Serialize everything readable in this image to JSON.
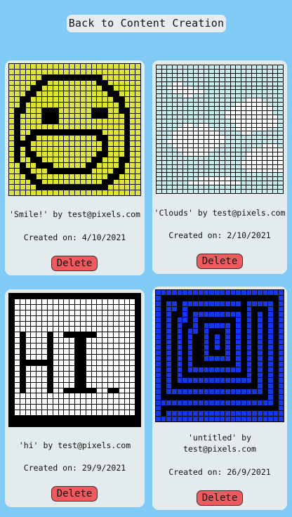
{
  "header": {
    "back_label": "Back to Content Creation"
  },
  "colors": {
    "page_bg": "#7fcbf5",
    "card_bg": "#e4ebec",
    "delete_bg": "#ef5a5f",
    "grid_line": "#000000"
  },
  "cards": [
    {
      "caption": "'Smile!' by test@pixels.com",
      "created": "Created on: 4/10/2021",
      "delete_label": "Delete",
      "palette": {
        "0": "#dde23c",
        "1": "#000000"
      },
      "pixels": [
        "000000000000000000000000",
        "000000000000000000000000",
        "000000111111111110000000",
        "000001100000000011000000",
        "000011000000000001100000",
        "000110000000000000110000",
        "001100000000000000011000",
        "001000000000000000001000",
        "011000111000000111001100",
        "010000111000000111000100",
        "010000111000000000000100",
        "010000000000000000000100",
        "010011111111111110000100",
        "010110000000000011000100",
        "011100000000000001000100",
        "010100000000000001000100",
        "010110000000000011000100",
        "010011000000000110001100",
        "001001110000001100001000",
        "001100011111111000011000",
        "000110000000000000110000",
        "000011000000000001100000",
        "000001111111111111000000",
        "000000000000000000000000"
      ]
    },
    {
      "caption": "'Clouds' by test@pixels.com",
      "created": "Created on: 2/10/2021",
      "delete_label": "Delete",
      "palette": {
        "0": "#c6ecef",
        "1": "#ffffff"
      },
      "pixels": [
        "000000000000000000000000",
        "000000000000000000000000",
        "000000000000000000000000",
        "000000000000000000000000",
        "000110000000000000000000",
        "001111100000000000000000",
        "000111111000000000000000",
        "000001100000000000000000",
        "000000000000000001110000",
        "000000000000000111111000",
        "000000000000001111111100",
        "000000000000011111111100",
        "000000000000011111111110",
        "000000000000001111111110",
        "000001101100000111111110",
        "000011111110000111111000",
        "000111111111000011000000",
        "000111111111100000000000",
        "001111111111100000000000",
        "000111111111000000001110",
        "000011111110000000111111",
        "000001111100000001111111",
        "000000000000000001111111",
        "000000000000000011111111",
        "000000000000000011111111",
        "000000000000000001111111",
        "000000000000000000000000",
        "000000001111110000000000",
        "000000111111111100000000",
        "000000000000000000000000",
        "000000000000000000000000"
      ]
    },
    {
      "caption": "'hi' by test@pixels.com",
      "created": "Created on: 29/9/2021",
      "delete_label": "Delete",
      "palette": {
        "0": "#ffffff",
        "1": "#000000"
      },
      "pixels": [
        "111111111111111111111111",
        "100000000000000000000001",
        "100000000000000000000001",
        "100000000000000000000001",
        "100000000000000000000001",
        "100000000000000000000001",
        "100000000000000000000001",
        "101000010011111100000001",
        "101000010000110000000001",
        "101000010000110000000001",
        "101000010000110000000001",
        "101000010000110000000001",
        "101111110000110000000001",
        "101000010000110000000001",
        "101000010000110000000001",
        "101000010000110000000001",
        "101000010000110000000001",
        "101000010011111100110001",
        "100000000000000000000001",
        "100000000000000000000001",
        "100000000000000000000001",
        "100000000000000000000001",
        "111111111111111111111111",
        "111111111111111111111111"
      ]
    },
    {
      "caption": "'untitled' by test@pixels.com",
      "created": "Created on: 26/9/2021",
      "delete_label": "Delete",
      "palette": {
        "0": "#000000",
        "1": "#1438e6"
      },
      "pixels": [
        "111111111111111111111111",
        "100000000000000000000001",
        "101101111111111101111101",
        "101101000000000001000101",
        "101001011111111101010101",
        "101011010000000101010101",
        "101010010111110101010101",
        "101010110100010101010101",
        "101010100101010101010101",
        "101010100101010101010101",
        "101010100101010101010101",
        "101010100100010101010101",
        "101010100111110101010101",
        "101010100000000101010101",
        "101010111111111101010101",
        "101010000000000001010101",
        "101011111111111111010101",
        "101000000000000000010101",
        "101111111111111111110101",
        "100000000000000000000101",
        "111111111111111111111101",
        "100000000000000000000001",
        "101111111111111111111111",
        "111111111111111111111111"
      ]
    }
  ]
}
